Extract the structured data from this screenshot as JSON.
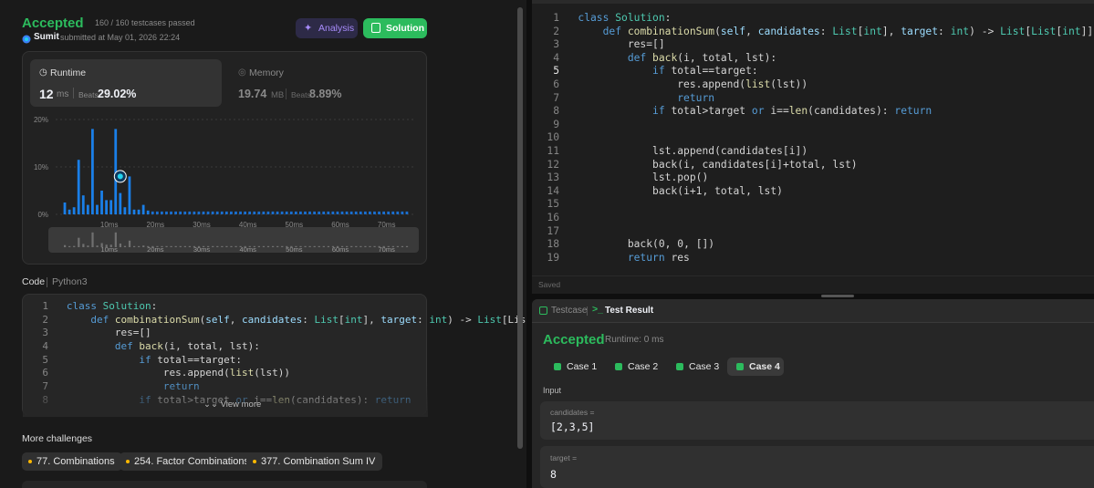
{
  "submission": {
    "status": "Accepted",
    "testcases": "160 / 160 testcases passed",
    "user": "Sumit",
    "submitted_text": "submitted at May 01, 2026 22:24",
    "analysis_label": "Analysis",
    "solution_label": "Solution"
  },
  "runtime": {
    "label": "Runtime",
    "value": "12",
    "unit": "ms",
    "beats_label": "Beats",
    "beats_value": "29.02%"
  },
  "memory": {
    "label": "Memory",
    "value": "19.74",
    "unit": "MB",
    "beats_label": "Beats",
    "beats_value": "8.89%"
  },
  "chart_data": {
    "type": "bar",
    "title": "",
    "xlabel": "",
    "ylabel": "",
    "y_ticks": [
      "20%",
      "10%",
      "0%"
    ],
    "x_ticks": [
      "10ms",
      "20ms",
      "30ms",
      "40ms",
      "50ms",
      "60ms",
      "70ms"
    ],
    "ylim": [
      0,
      20
    ],
    "xlim": [
      0,
      75
    ],
    "grid": true,
    "x": [
      0,
      1,
      2,
      3,
      4,
      5,
      6,
      7,
      8,
      9,
      10,
      11,
      12,
      13,
      14,
      15,
      16,
      17,
      18,
      19,
      20,
      21,
      22,
      23,
      24,
      25,
      26,
      27,
      28,
      29,
      30,
      31,
      32,
      33,
      34,
      35,
      36,
      37,
      38,
      39,
      40,
      41,
      42,
      43,
      44,
      45,
      46,
      47,
      48,
      49,
      50,
      51,
      52,
      53,
      54,
      55,
      56,
      57,
      58,
      59,
      60,
      61,
      62,
      63,
      64,
      65,
      66,
      67,
      68,
      69,
      70,
      71,
      72,
      73,
      74
    ],
    "values": [
      2.5,
      1,
      1.5,
      11.5,
      4,
      2,
      18,
      2,
      5,
      3,
      3,
      18,
      4.5,
      1.5,
      8,
      1,
      1,
      2,
      0.8,
      0.6,
      0.6,
      0.6,
      0.6,
      0.6,
      0.6,
      0.6,
      0.6,
      0.6,
      0.6,
      0.6,
      0.6,
      0.6,
      0.6,
      0.6,
      0.6,
      0.6,
      0.6,
      0.6,
      0.6,
      0.6,
      0.6,
      0.6,
      0.6,
      0.6,
      0.6,
      0.6,
      0.6,
      0.6,
      0.6,
      0.6,
      0.6,
      0.6,
      0.6,
      0.6,
      0.6,
      0.6,
      0.6,
      0.6,
      0.6,
      0.6,
      0.6,
      0.6,
      0.6,
      0.6,
      0.6,
      0.6,
      0.6,
      0.6,
      0.6,
      0.6,
      0.6,
      0.6,
      0.6,
      0.6,
      0.6
    ],
    "highlight_x": 12,
    "mini_ticks": [
      "10ms",
      "20ms",
      "30ms",
      "40ms",
      "50ms",
      "60ms",
      "70ms"
    ]
  },
  "code_panel": {
    "label": "Code",
    "lang": "Python3",
    "view_more": "View more",
    "lines": [
      "class Solution:",
      "    def combinationSum(self, candidates: List[int], target: int) -> List[Lis",
      "        res=[]",
      "        def back(i, total, lst):",
      "            if total==target:",
      "                res.append(list(lst))",
      "                return",
      "            if total>target or i==len(candidates): return"
    ]
  },
  "more": {
    "title": "More challenges",
    "items": [
      "77. Combinations",
      "254. Factor Combinations",
      "377. Combination Sum IV"
    ]
  },
  "editor": {
    "saved": "Saved",
    "lines": [
      "class Solution:",
      "    def combinationSum(self, candidates: List[int], target: int) -> List[List[int]]:",
      "        res=[]",
      "        def back(i, total, lst):",
      "            if total==target:",
      "                res.append(list(lst))",
      "                return",
      "            if total>target or i==len(candidates): return",
      "",
      "",
      "            lst.append(candidates[i])",
      "            back(i, candidates[i]+total, lst)",
      "            lst.pop()",
      "            back(i+1, total, lst)",
      "",
      "",
      "",
      "        back(0, 0, [])",
      "        return res"
    ]
  },
  "result": {
    "tab_testcase": "Testcase",
    "tab_result": "Test Result",
    "status": "Accepted",
    "runtime": "Runtime: 0 ms",
    "cases": [
      "Case 1",
      "Case 2",
      "Case 3",
      "Case 4"
    ],
    "input_label": "Input",
    "candidates_label": "candidates =",
    "candidates_value": "[2,3,5]",
    "target_label": "target =",
    "target_value": "8"
  },
  "colors": {
    "accent": "#2cbb5d",
    "bar": "#1a7fe8",
    "analysis": "#a78bfa",
    "chip_dot": "#ffb800"
  }
}
